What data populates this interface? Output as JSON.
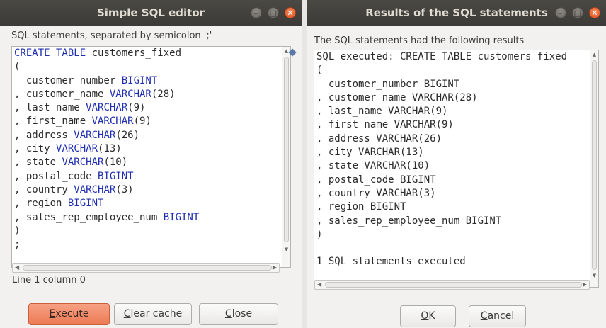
{
  "editor_window": {
    "title": "Simple SQL editor",
    "instruction": "SQL statements, separated by semicolon ';'",
    "sql_lines": [
      [
        [
          "CREATE TABLE",
          "kw"
        ],
        [
          " customers_fixed",
          ""
        ]
      ],
      [
        [
          "(",
          ""
        ]
      ],
      [
        [
          "  customer_number ",
          ""
        ],
        [
          "BIGINT",
          "kw"
        ]
      ],
      [
        [
          ", customer_name ",
          ""
        ],
        [
          "VARCHAR",
          "kw"
        ],
        [
          "(28)",
          ""
        ]
      ],
      [
        [
          ", last_name ",
          ""
        ],
        [
          "VARCHAR",
          "kw"
        ],
        [
          "(9)",
          ""
        ]
      ],
      [
        [
          ", first_name ",
          ""
        ],
        [
          "VARCHAR",
          "kw"
        ],
        [
          "(9)",
          ""
        ]
      ],
      [
        [
          ", address ",
          ""
        ],
        [
          "VARCHAR",
          "kw"
        ],
        [
          "(26)",
          ""
        ]
      ],
      [
        [
          ", city ",
          ""
        ],
        [
          "VARCHAR",
          "kw"
        ],
        [
          "(13)",
          ""
        ]
      ],
      [
        [
          ", state ",
          ""
        ],
        [
          "VARCHAR",
          "kw"
        ],
        [
          "(10)",
          ""
        ]
      ],
      [
        [
          ", postal_code ",
          ""
        ],
        [
          "BIGINT",
          "kw"
        ]
      ],
      [
        [
          ", country ",
          ""
        ],
        [
          "VARCHAR",
          "kw"
        ],
        [
          "(3)",
          ""
        ]
      ],
      [
        [
          ", region ",
          ""
        ],
        [
          "BIGINT",
          "kw"
        ]
      ],
      [
        [
          ", sales_rep_employee_num ",
          ""
        ],
        [
          "BIGINT",
          "kw"
        ]
      ],
      [
        [
          ")",
          ""
        ]
      ],
      [
        [
          ";",
          ""
        ]
      ]
    ],
    "cursor_status": "Line 1 column 0",
    "buttons": {
      "execute": {
        "mnemonic": "E",
        "rest": "xecute"
      },
      "clear_cache": {
        "mnemonic": "C",
        "rest": "lear cache"
      },
      "close": {
        "mnemonic": "C",
        "rest": "lose"
      }
    }
  },
  "results_window": {
    "title": "Results of the SQL statements",
    "instruction": "The SQL statements had the following results",
    "result_lines": [
      "SQL executed: CREATE TABLE customers_fixed",
      "(",
      "  customer_number BIGINT",
      ", customer_name VARCHAR(28)",
      ", last_name VARCHAR(9)",
      ", first_name VARCHAR(9)",
      ", address VARCHAR(26)",
      ", city VARCHAR(13)",
      ", state VARCHAR(10)",
      ", postal_code BIGINT",
      ", country VARCHAR(3)",
      ", region BIGINT",
      ", sales_rep_employee_num BIGINT",
      ")",
      "",
      "1 SQL statements executed"
    ],
    "buttons": {
      "ok": {
        "mnemonic": "O",
        "rest": "K"
      },
      "cancel": {
        "mnemonic": "C",
        "rest": "ancel"
      }
    }
  },
  "colors": {
    "keyword": "#1f2fb0",
    "titlebar": "#3b3a36",
    "primary_button": "#ec7a55",
    "window_bg": "#f2f1f0"
  },
  "icons": [
    "minimize-icon",
    "maximize-icon",
    "close-icon",
    "scroll-up-arrow-icon",
    "scroll-down-arrow-icon",
    "scroll-left-arrow-icon",
    "scroll-right-arrow-icon"
  ]
}
